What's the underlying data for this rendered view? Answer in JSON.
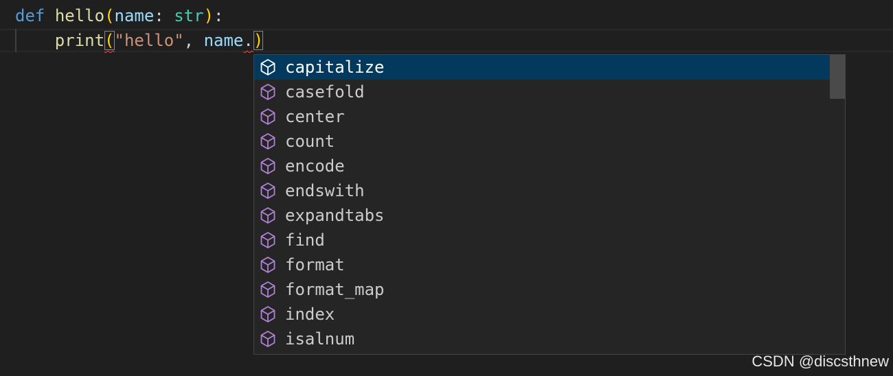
{
  "editor": {
    "line1": {
      "kw_def": "def",
      "fn_name": "hello",
      "open_paren": "(",
      "param_name": "name",
      "colon": ": ",
      "param_type": "str",
      "close_paren": ")",
      "end_colon": ":"
    },
    "line2": {
      "indent": "    ",
      "fn_print": "print",
      "open_paren": "(",
      "string": "\"hello\"",
      "comma": ", ",
      "arg": "name",
      "dot": ".",
      "close_paren": ")"
    }
  },
  "suggest": {
    "items": [
      {
        "label": "capitalize",
        "icon": "cube-icon",
        "selected": true
      },
      {
        "label": "casefold",
        "icon": "cube-icon"
      },
      {
        "label": "center",
        "icon": "cube-icon"
      },
      {
        "label": "count",
        "icon": "cube-icon"
      },
      {
        "label": "encode",
        "icon": "cube-icon"
      },
      {
        "label": "endswith",
        "icon": "cube-icon"
      },
      {
        "label": "expandtabs",
        "icon": "cube-icon"
      },
      {
        "label": "find",
        "icon": "cube-icon"
      },
      {
        "label": "format",
        "icon": "cube-icon"
      },
      {
        "label": "format_map",
        "icon": "cube-icon"
      },
      {
        "label": "index",
        "icon": "cube-icon"
      },
      {
        "label": "isalnum",
        "icon": "cube-icon"
      }
    ]
  },
  "watermark": "CSDN @discsthnew",
  "colors": {
    "background": "#1f1f1f",
    "selected_row": "#04395e",
    "method_icon": "#b180d7",
    "selected_icon": "#ffffff"
  }
}
